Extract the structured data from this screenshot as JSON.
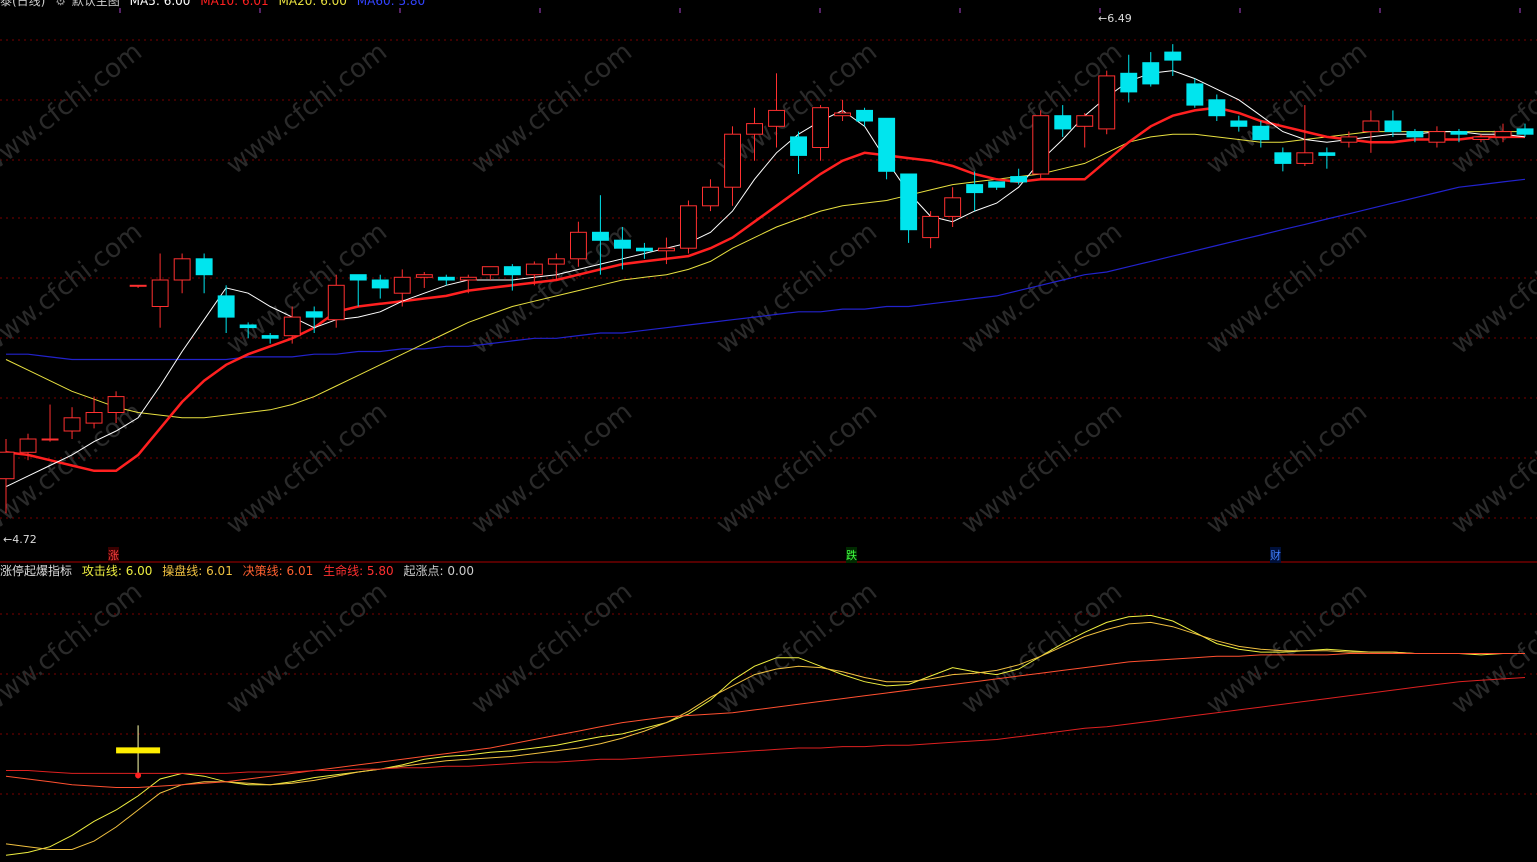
{
  "colors": {
    "background": "#000000",
    "up": "#ff3030",
    "down": "#00e5ee",
    "ma5": "#ffffff",
    "ma10": "#ff2020",
    "ma20": "#e8e040",
    "ma60": "#2222cc",
    "gridline": "#7a0000",
    "watermark": "#2a2a2a"
  },
  "top_legend": {
    "name": "泰(日线)",
    "gear_icon": "gear-icon",
    "template": "默认主图",
    "ma5": "MA5: 6.00",
    "ma10": "MA10: 6.01",
    "ma20": "MA20: 6.00",
    "ma60": "MA60: 5.80"
  },
  "price_annotations": {
    "high": "6.49",
    "low": "4.72"
  },
  "markers": [
    {
      "text": "涨",
      "color": "#ff4040"
    },
    {
      "text": "跌",
      "color": "#40ff40"
    },
    {
      "text": "财",
      "color": "#4080ff"
    }
  ],
  "indicator_legend": {
    "name": "涨停起爆指标",
    "attack": "攻击线: 6.00",
    "control": "操盘线: 6.01",
    "decision": "决策线: 6.01",
    "life": "生命线: 5.80",
    "start": "起涨点: 0.00"
  },
  "watermark_text": "www.cfchi.com",
  "chart_data": [
    {
      "type": "candlestick",
      "ylim": [
        4.6,
        6.6
      ],
      "candles": [
        [
          4.85,
          4.95,
          4.72,
          5.0
        ],
        [
          4.95,
          5.0,
          4.92,
          5.02
        ],
        [
          5.0,
          5.0,
          4.99,
          5.13
        ],
        [
          5.03,
          5.08,
          5.0,
          5.12
        ],
        [
          5.06,
          5.1,
          5.04,
          5.16
        ],
        [
          5.1,
          5.16,
          5.06,
          5.18
        ],
        [
          5.58,
          5.58,
          5.57,
          5.58
        ],
        [
          5.5,
          5.6,
          5.42,
          5.7
        ],
        [
          5.6,
          5.68,
          5.55,
          5.7
        ],
        [
          5.68,
          5.62,
          5.55,
          5.7
        ],
        [
          5.54,
          5.46,
          5.4,
          5.58
        ],
        [
          5.43,
          5.42,
          5.38,
          5.44
        ],
        [
          5.39,
          5.38,
          5.36,
          5.4
        ],
        [
          5.39,
          5.46,
          5.36,
          5.5
        ],
        [
          5.48,
          5.46,
          5.4,
          5.5
        ],
        [
          5.45,
          5.58,
          5.42,
          5.62
        ],
        [
          5.62,
          5.6,
          5.5,
          5.62
        ],
        [
          5.6,
          5.57,
          5.53,
          5.62
        ],
        [
          5.55,
          5.61,
          5.5,
          5.64
        ],
        [
          5.61,
          5.62,
          5.57,
          5.63
        ],
        [
          5.61,
          5.6,
          5.58,
          5.62
        ],
        [
          5.6,
          5.61,
          5.55,
          5.62
        ],
        [
          5.62,
          5.65,
          5.6,
          5.65
        ],
        [
          5.65,
          5.62,
          5.56,
          5.66
        ],
        [
          5.62,
          5.66,
          5.58,
          5.67
        ],
        [
          5.66,
          5.68,
          5.6,
          5.7
        ],
        [
          5.68,
          5.78,
          5.65,
          5.82
        ],
        [
          5.78,
          5.75,
          5.62,
          5.92
        ],
        [
          5.75,
          5.72,
          5.64,
          5.8
        ],
        [
          5.72,
          5.71,
          5.68,
          5.74
        ],
        [
          5.71,
          5.72,
          5.66,
          5.76
        ],
        [
          5.72,
          5.88,
          5.7,
          5.9
        ],
        [
          5.88,
          5.95,
          5.86,
          5.98
        ],
        [
          5.95,
          6.15,
          5.88,
          6.18
        ],
        [
          6.15,
          6.19,
          6.05,
          6.25
        ],
        [
          6.18,
          6.24,
          6.1,
          6.38
        ],
        [
          6.14,
          6.07,
          6.0,
          6.16
        ],
        [
          6.1,
          6.25,
          6.05,
          6.26
        ],
        [
          6.22,
          6.23,
          6.2,
          6.28
        ],
        [
          6.24,
          6.2,
          6.18,
          6.25
        ],
        [
          6.21,
          6.01,
          5.98,
          6.21
        ],
        [
          6.0,
          5.79,
          5.74,
          6.0
        ],
        [
          5.76,
          5.84,
          5.72,
          5.86
        ],
        [
          5.84,
          5.91,
          5.8,
          5.95
        ],
        [
          5.96,
          5.93,
          5.86,
          6.01
        ],
        [
          5.97,
          5.95,
          5.94,
          5.97
        ],
        [
          5.99,
          5.97,
          5.96,
          6.02
        ],
        [
          6.0,
          6.22,
          5.98,
          6.24
        ],
        [
          6.22,
          6.17,
          6.14,
          6.26
        ],
        [
          6.18,
          6.22,
          6.1,
          6.23
        ],
        [
          6.17,
          6.37,
          6.15,
          6.39
        ],
        [
          6.38,
          6.31,
          6.27,
          6.45
        ],
        [
          6.42,
          6.34,
          6.33,
          6.46
        ],
        [
          6.46,
          6.43,
          6.37,
          6.49
        ],
        [
          6.34,
          6.26,
          6.25,
          6.36
        ],
        [
          6.28,
          6.22,
          6.2,
          6.3
        ],
        [
          6.2,
          6.18,
          6.16,
          6.22
        ],
        [
          6.18,
          6.13,
          6.1,
          6.2
        ],
        [
          6.08,
          6.04,
          6.01,
          6.1
        ],
        [
          6.04,
          6.08,
          6.03,
          6.26
        ],
        [
          6.08,
          6.07,
          6.02,
          6.1
        ],
        [
          6.12,
          6.14,
          6.1,
          6.16
        ],
        [
          6.16,
          6.2,
          6.08,
          6.24
        ],
        [
          6.2,
          6.16,
          6.14,
          6.24
        ],
        [
          6.16,
          6.14,
          6.12,
          6.17
        ],
        [
          6.12,
          6.16,
          6.1,
          6.18
        ],
        [
          6.16,
          6.15,
          6.12,
          6.17
        ],
        [
          6.13,
          6.14,
          6.12,
          6.15
        ],
        [
          6.14,
          6.16,
          6.12,
          6.19
        ],
        [
          6.17,
          6.15,
          6.14,
          6.19
        ]
      ],
      "ma5": [
        4.82,
        4.86,
        4.9,
        4.94,
        4.99,
        5.03,
        5.08,
        5.2,
        5.33,
        5.45,
        5.57,
        5.55,
        5.5,
        5.46,
        5.42,
        5.45,
        5.46,
        5.48,
        5.52,
        5.55,
        5.58,
        5.6,
        5.6,
        5.6,
        5.61,
        5.62,
        5.64,
        5.66,
        5.68,
        5.7,
        5.72,
        5.74,
        5.78,
        5.86,
        5.98,
        6.08,
        6.15,
        6.2,
        6.24,
        6.18,
        6.05,
        5.93,
        5.84,
        5.82,
        5.86,
        5.89,
        5.95,
        6.05,
        6.13,
        6.22,
        6.29,
        6.35,
        6.38,
        6.39,
        6.36,
        6.32,
        6.28,
        6.22,
        6.16,
        6.13,
        6.12,
        6.13,
        6.14,
        6.15,
        6.15,
        6.16,
        6.16,
        6.15,
        6.15,
        6.14
      ],
      "ma10": [
        4.95,
        4.94,
        4.92,
        4.9,
        4.88,
        4.88,
        4.94,
        5.04,
        5.14,
        5.22,
        5.28,
        5.32,
        5.35,
        5.38,
        5.42,
        5.48,
        5.5,
        5.51,
        5.52,
        5.53,
        5.54,
        5.56,
        5.57,
        5.58,
        5.59,
        5.6,
        5.62,
        5.64,
        5.66,
        5.67,
        5.68,
        5.69,
        5.72,
        5.76,
        5.82,
        5.88,
        5.94,
        6.0,
        6.05,
        6.08,
        6.07,
        6.06,
        6.05,
        6.03,
        6.0,
        5.98,
        5.97,
        5.98,
        5.98,
        5.98,
        6.05,
        6.12,
        6.18,
        6.22,
        6.24,
        6.25,
        6.23,
        6.2,
        6.18,
        6.16,
        6.14,
        6.13,
        6.12,
        6.12,
        6.13,
        6.13,
        6.13,
        6.14,
        6.14,
        6.14
      ],
      "ma20": [
        5.3,
        5.26,
        5.22,
        5.18,
        5.15,
        5.12,
        5.1,
        5.09,
        5.08,
        5.08,
        5.09,
        5.1,
        5.11,
        5.13,
        5.16,
        5.2,
        5.24,
        5.28,
        5.32,
        5.36,
        5.4,
        5.44,
        5.47,
        5.5,
        5.52,
        5.54,
        5.56,
        5.58,
        5.6,
        5.61,
        5.62,
        5.64,
        5.67,
        5.72,
        5.76,
        5.8,
        5.83,
        5.86,
        5.88,
        5.89,
        5.9,
        5.92,
        5.94,
        5.96,
        5.97,
        5.98,
        5.99,
        6.0,
        6.02,
        6.04,
        6.08,
        6.12,
        6.14,
        6.15,
        6.15,
        6.14,
        6.13,
        6.12,
        6.12,
        6.13,
        6.14,
        6.15,
        6.16,
        6.16,
        6.16,
        6.16,
        6.16,
        6.16,
        6.16,
        6.16
      ],
      "ma60": [
        5.32,
        5.32,
        5.31,
        5.3,
        5.3,
        5.3,
        5.3,
        5.3,
        5.3,
        5.3,
        5.3,
        5.31,
        5.31,
        5.31,
        5.32,
        5.32,
        5.33,
        5.33,
        5.34,
        5.34,
        5.35,
        5.35,
        5.36,
        5.37,
        5.38,
        5.38,
        5.39,
        5.4,
        5.4,
        5.41,
        5.42,
        5.43,
        5.44,
        5.45,
        5.46,
        5.47,
        5.48,
        5.48,
        5.49,
        5.49,
        5.5,
        5.5,
        5.51,
        5.52,
        5.53,
        5.54,
        5.56,
        5.58,
        5.6,
        5.62,
        5.63,
        5.65,
        5.67,
        5.69,
        5.71,
        5.73,
        5.75,
        5.77,
        5.79,
        5.81,
        5.83,
        5.85,
        5.87,
        5.89,
        5.91,
        5.93,
        5.95,
        5.96,
        5.97,
        5.98
      ]
    },
    {
      "type": "line",
      "ylim": [
        4.7,
        6.6
      ],
      "series": [
        {
          "name": "攻击线",
          "color": "#eeee40",
          "values": [
            4.72,
            4.74,
            4.78,
            4.86,
            4.96,
            5.04,
            5.14,
            5.26,
            5.3,
            5.28,
            5.24,
            5.22,
            5.22,
            5.24,
            5.27,
            5.29,
            5.31,
            5.33,
            5.36,
            5.4,
            5.42,
            5.43,
            5.45,
            5.46,
            5.48,
            5.5,
            5.53,
            5.56,
            5.58,
            5.62,
            5.66,
            5.72,
            5.82,
            5.96,
            6.06,
            6.12,
            6.12,
            6.06,
            6.0,
            5.95,
            5.92,
            5.93,
            5.99,
            6.05,
            6.02,
            6.0,
            6.04,
            6.13,
            6.22,
            6.3,
            6.37,
            6.41,
            6.42,
            6.38,
            6.3,
            6.22,
            6.18,
            6.16,
            6.16,
            6.17,
            6.18,
            6.17,
            6.16,
            6.16,
            6.15,
            6.15,
            6.15,
            6.14,
            6.15,
            6.15
          ]
        },
        {
          "name": "操盘线",
          "color": "#f0c040",
          "values": [
            4.8,
            4.78,
            4.76,
            4.76,
            4.82,
            4.92,
            5.04,
            5.16,
            5.22,
            5.24,
            5.24,
            5.23,
            5.22,
            5.23,
            5.25,
            5.28,
            5.31,
            5.33,
            5.35,
            5.37,
            5.39,
            5.4,
            5.41,
            5.42,
            5.44,
            5.46,
            5.48,
            5.51,
            5.55,
            5.6,
            5.66,
            5.74,
            5.84,
            5.92,
            6.0,
            6.04,
            6.06,
            6.05,
            6.02,
            5.98,
            5.95,
            5.95,
            5.97,
            6.0,
            6.01,
            6.03,
            6.07,
            6.13,
            6.2,
            6.27,
            6.32,
            6.36,
            6.37,
            6.34,
            6.29,
            6.24,
            6.2,
            6.18,
            6.17,
            6.17,
            6.17,
            6.16,
            6.16,
            6.16,
            6.15,
            6.15,
            6.15,
            6.15,
            6.15,
            6.15
          ]
        },
        {
          "name": "决策线",
          "color": "#ff5030",
          "values": [
            5.28,
            5.26,
            5.24,
            5.22,
            5.21,
            5.2,
            5.2,
            5.21,
            5.22,
            5.23,
            5.24,
            5.26,
            5.28,
            5.3,
            5.32,
            5.34,
            5.36,
            5.38,
            5.4,
            5.42,
            5.44,
            5.46,
            5.48,
            5.51,
            5.54,
            5.57,
            5.6,
            5.63,
            5.66,
            5.68,
            5.7,
            5.71,
            5.72,
            5.73,
            5.75,
            5.77,
            5.79,
            5.81,
            5.83,
            5.85,
            5.87,
            5.89,
            5.91,
            5.93,
            5.95,
            5.97,
            5.99,
            6.01,
            6.03,
            6.05,
            6.07,
            6.09,
            6.1,
            6.11,
            6.12,
            6.13,
            6.13,
            6.14,
            6.14,
            6.14,
            6.14,
            6.15,
            6.15,
            6.15,
            6.15,
            6.15,
            6.15,
            6.15,
            6.15,
            6.15
          ]
        },
        {
          "name": "生命线",
          "color": "#dd2020",
          "values": [
            5.32,
            5.32,
            5.31,
            5.3,
            5.3,
            5.3,
            5.3,
            5.3,
            5.3,
            5.3,
            5.3,
            5.31,
            5.31,
            5.31,
            5.32,
            5.32,
            5.33,
            5.33,
            5.34,
            5.34,
            5.35,
            5.35,
            5.36,
            5.37,
            5.38,
            5.38,
            5.39,
            5.4,
            5.4,
            5.41,
            5.42,
            5.43,
            5.44,
            5.45,
            5.46,
            5.47,
            5.48,
            5.48,
            5.49,
            5.49,
            5.5,
            5.5,
            5.51,
            5.52,
            5.53,
            5.54,
            5.56,
            5.58,
            5.6,
            5.62,
            5.63,
            5.65,
            5.67,
            5.69,
            5.71,
            5.73,
            5.75,
            5.77,
            5.79,
            5.81,
            5.83,
            5.85,
            5.87,
            5.89,
            5.91,
            5.93,
            5.95,
            5.96,
            5.97,
            5.98
          ]
        }
      ],
      "signal_bar": {
        "index": 6,
        "value": 5.3,
        "color": "#ffee00"
      }
    }
  ]
}
